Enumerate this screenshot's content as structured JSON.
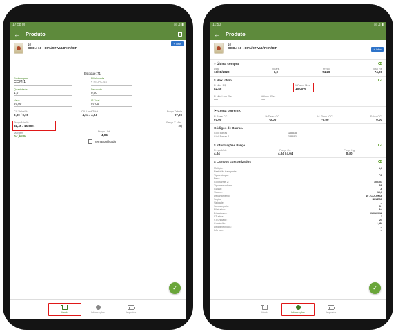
{
  "colors": {
    "appbar": "#5e8a3c",
    "accent": "#4c8a2a",
    "info_button": "#2e73c9",
    "highlight": "#e01818",
    "fab": "#6aa63a"
  },
  "left": {
    "status": {
      "time": "17:58 M",
      "icons": "◎ ⊿ ▮"
    },
    "title": "Produto",
    "info_button": "+ Infos",
    "product": {
      "name": "10",
      "code": "COD.: 10 - 10%/ST-VLI/IPI-N/DIF"
    },
    "estoque": "Estoque: 71",
    "embalagem": {
      "label": "Embalagem",
      "value": "COM 1"
    },
    "filial": {
      "label": "Filial venda",
      "value": "FILIAL 44"
    },
    "quantidade": {
      "label": "Quantidade",
      "value": "1,0"
    },
    "desconto": {
      "label": "Desconto",
      "value": "0,00"
    },
    "valor": {
      "label": "Valor",
      "value": "97,00"
    },
    "vl_total": {
      "label": "Vl Total",
      "value": "97,00"
    },
    "cc_valor": {
      "label": "CC Valor/%",
      "value": "0,00 / 0,00"
    },
    "cx_unid": {
      "label": "CX. Unid/Total",
      "value": "4,04 / 4,04"
    },
    "preco_tabela": {
      "label": "Preço Tabela",
      "value": "97,00"
    },
    "preco_min": {
      "label": "Preço Min/%",
      "value": "82,45 / 15,00%"
    },
    "preco_max": {
      "label": "Preço X Máx.",
      "value": "(0)"
    },
    "margem": {
      "label": "Margem",
      "value": "32,46%"
    },
    "preco_unit": {
      "label": "Preço Unit.",
      "value": "4,04"
    },
    "bonificado": "Item Bonificado",
    "nav": [
      {
        "label": "Venda"
      },
      {
        "label": "Informações"
      },
      {
        "label": "Impostos"
      }
    ]
  },
  "right": {
    "status": {
      "time": "11:50",
      "icons": "◎ ⊿ ▮"
    },
    "title": "Produto",
    "info_button": "+ Infos",
    "product": {
      "name": "10",
      "code": "COD.: 10 - 10%/ST-VLI/IPI-N/DIF"
    },
    "ultima_compra": {
      "title": "Última compra",
      "cols": [
        {
          "label": "Data",
          "value": "16/08/2022"
        },
        {
          "label": "Quant.",
          "value": "1,0"
        },
        {
          "label": "Preço",
          "value": "74,20"
        },
        {
          "label": "Total R$",
          "value": "74,20"
        }
      ]
    },
    "max_min": {
      "title": "$ Máx. / Mín.",
      "pmin_label": "P. Mín. R$",
      "pmin_value": "82,45",
      "desc_label": "%Desc. Máx.",
      "desc_value": "15,00%",
      "pmax_label": "P. Mín Lucr Flex.",
      "pmax_value": "----",
      "descflex_label": "%Desc. Flex.",
      "descflex_value": "----"
    },
    "conta": {
      "title": "Conta corrente.",
      "cols": [
        {
          "label": "P. Base CC.",
          "value": "97,00"
        },
        {
          "label": "% Desc. CC.",
          "value": "-0,00"
        },
        {
          "label": "Vl. Desc. CC.",
          "value": "-0,00"
        },
        {
          "label": "Saldo CC.",
          "value": "0,00"
        }
      ]
    },
    "barras": {
      "title": "Códigos de Barras.",
      "rows": [
        {
          "k": "Cód. Barras",
          "v": "100010"
        },
        {
          "k": "Cód. Barras 2",
          "v": "100101"
        }
      ]
    },
    "precos": {
      "title": "Informações Preço",
      "cols": [
        {
          "label": "Preço Unit.",
          "value": "4,04"
        },
        {
          "label": "Preço Cx.",
          "value": "4,04 / 4,04"
        },
        {
          "label": "Preço Kg",
          "value": "0,40"
        }
      ]
    },
    "campos": {
      "title": "Campos customizados",
      "rows": [
        {
          "k": "Múltiplo:",
          "v": "1,0"
        },
        {
          "k": "Restrição transporte:",
          "v": "--"
        },
        {
          "k": "Tipo estoque:",
          "v": "PA"
        },
        {
          "k": "Peso:",
          "v": "--"
        },
        {
          "k": "Cod.barras 2:",
          "v": "100101"
        },
        {
          "k": "Tipo mercadoria:",
          "v": "PA"
        },
        {
          "k": "Classe:",
          "v": "A"
        },
        {
          "k": "Volume:",
          "v": "10,0"
        },
        {
          "k": "Departamento:",
          "v": "10 - COLÔNIA"
        },
        {
          "k": "Seção:",
          "v": "BELEZA"
        },
        {
          "k": "Validade:",
          "v": "--"
        },
        {
          "k": "Subcategoria:",
          "v": "3 -"
        },
        {
          "k": "Filial ativo:",
          "v": "A4"
        },
        {
          "k": "Dt.cadastro:",
          "v": "01/01/2012"
        },
        {
          "k": "ST ativa:",
          "v": "1"
        },
        {
          "k": "ST unidade:",
          "v": "24"
        },
        {
          "k": "Comissão:",
          "v": "1,0%"
        },
        {
          "k": "Dados técnicos:",
          "v": "--"
        },
        {
          "k": "Info nav.:",
          "v": "--"
        }
      ]
    },
    "nav": [
      {
        "label": "Venda"
      },
      {
        "label": "Informações"
      },
      {
        "label": "Impostos"
      }
    ]
  }
}
